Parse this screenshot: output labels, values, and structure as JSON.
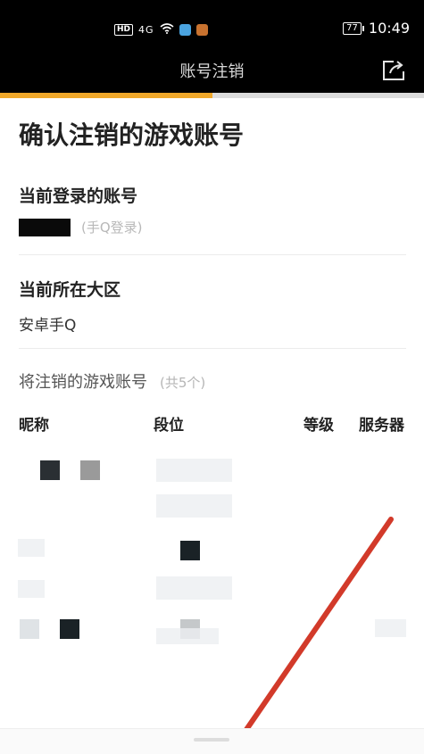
{
  "status": {
    "hd": "HD",
    "signal": "4G",
    "time": "10:49",
    "battery": "77"
  },
  "header": {
    "title": "账号注销",
    "share_icon": "share-icon"
  },
  "progress": {
    "fraction": 0.5
  },
  "page": {
    "heading": "确认注销的游戏账号",
    "current_account_label": "当前登录的账号",
    "login_method": "(手Q登录)",
    "current_region_label": "当前所在大区",
    "current_region_value": "安卓手Q",
    "accounts_label": "将注销的游戏账号",
    "accounts_count": "(共5个)"
  },
  "table": {
    "headers": [
      "昵称",
      "段位",
      "等级",
      "服务器"
    ]
  },
  "colors": {
    "accent": "#f0a82a",
    "arrow": "#d23a2a"
  }
}
